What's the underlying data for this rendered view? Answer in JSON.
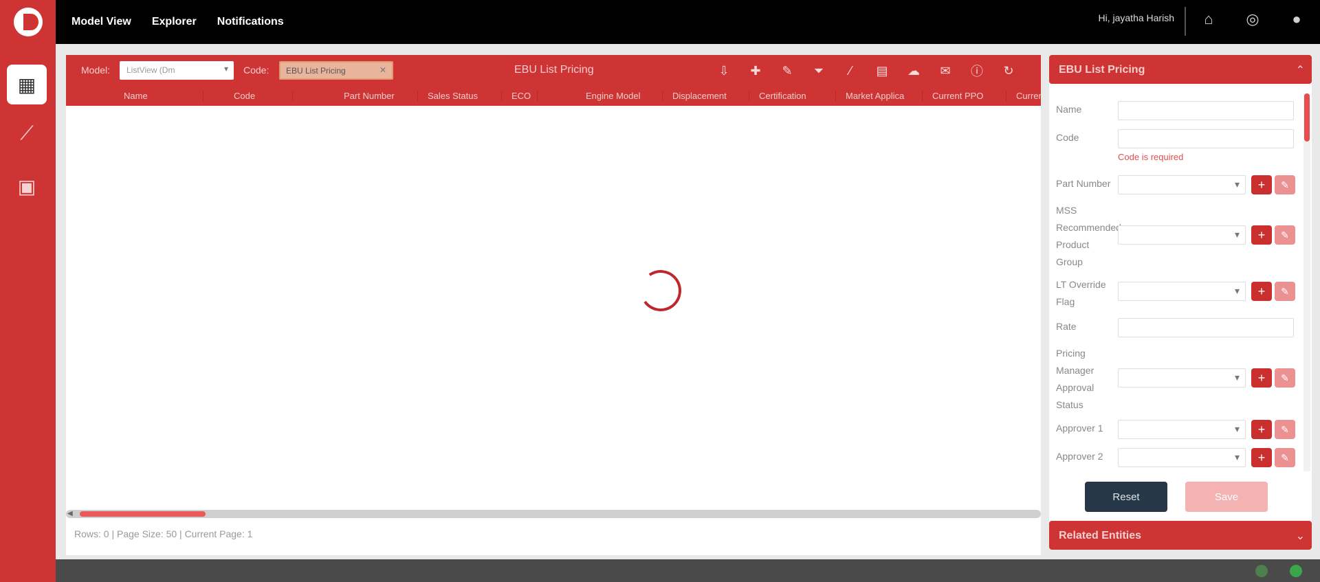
{
  "nav": {
    "items": [
      "Model View",
      "Explorer",
      "Notifications"
    ],
    "greeting": "Hi, jayatha Harish"
  },
  "toolbar": {
    "model_label": "Model:",
    "model_value": "ListView (Dm",
    "code_label": "Code:",
    "code_value": "EBU List Pricing",
    "title": "EBU List Pricing"
  },
  "grid": {
    "columns": [
      "",
      "Name",
      "",
      "Code",
      "",
      "Part Number",
      "Sales Status",
      "ECO",
      "",
      "Engine Model",
      "Displacement",
      "Certification",
      "Market Applica",
      "Current PPO",
      "Curren"
    ],
    "footer": "Rows: 0 | Page Size: 50 | Current Page: 1"
  },
  "form": {
    "title": "EBU List Pricing",
    "fields": {
      "name": "Name",
      "code": "Code",
      "code_error": "Code is required",
      "part_number": "Part Number",
      "mss": "MSS Recommended Product Group",
      "lt_override": "LT Override Flag",
      "rate": "Rate",
      "pricing_manager": "Pricing Manager Approval Status",
      "approver1": "Approver 1",
      "approver2": "Approver 2"
    },
    "reset_label": "Reset",
    "save_label": "Save",
    "related_title": "Related Entities"
  },
  "colors": {
    "brand_red": "#cf3434",
    "spinner_red": "#c0272d",
    "reset_navy": "#263848"
  }
}
